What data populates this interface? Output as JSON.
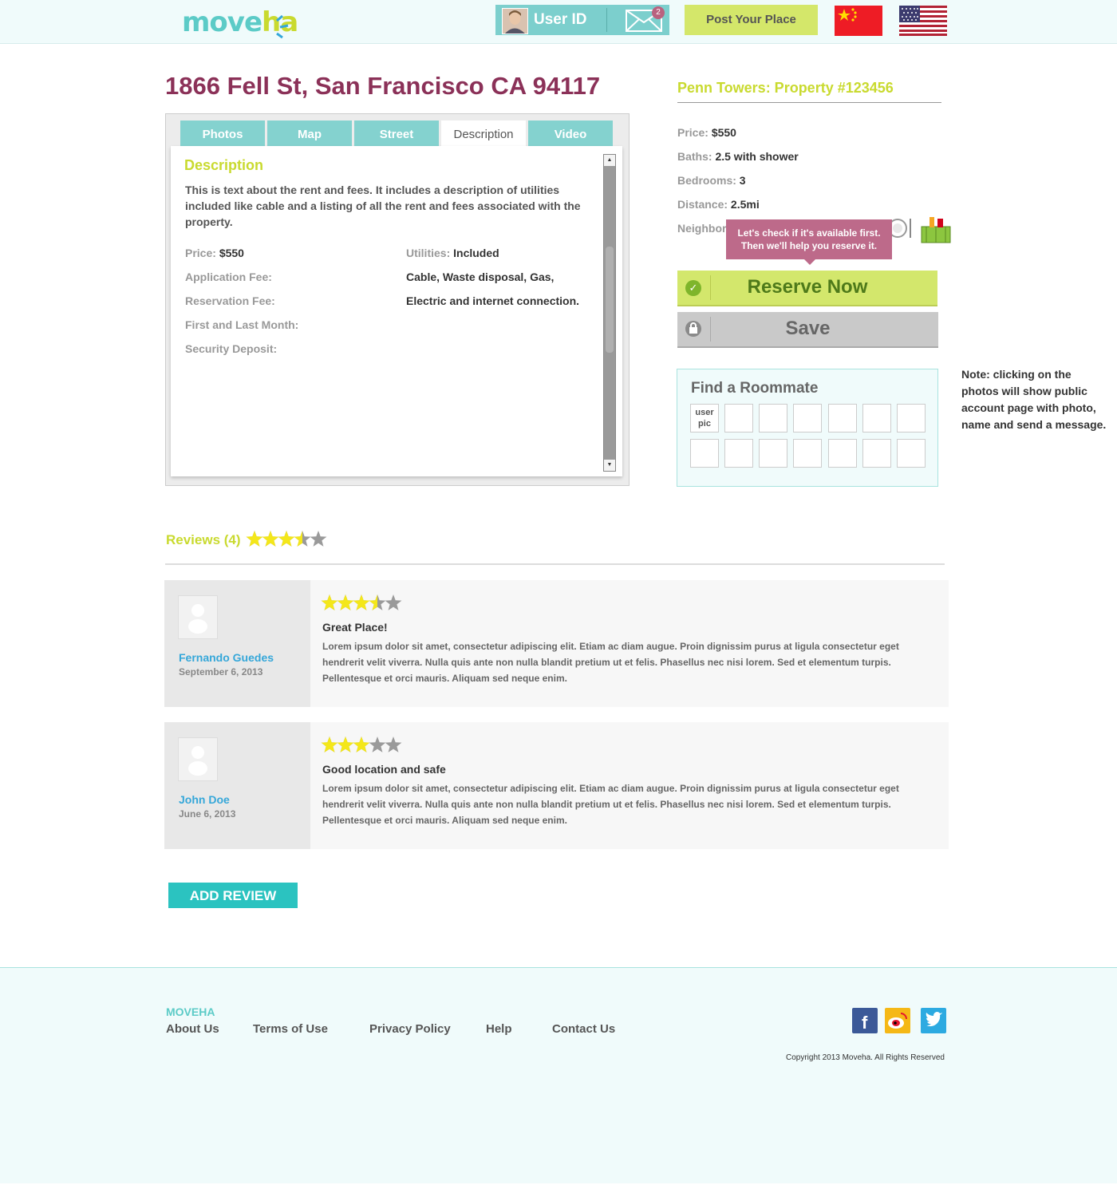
{
  "header": {
    "logo_part1": "move",
    "logo_part2": "ha",
    "user_label": "User ID",
    "mail_count": "2",
    "post_button": "Post Your Place",
    "flags": [
      "china-flag",
      "usa-flag"
    ]
  },
  "listing": {
    "address": "1866 Fell St, San Francisco CA 94117",
    "tabs": [
      "Photos",
      "Map",
      "Street",
      "Description",
      "Video"
    ],
    "active_tab": "Description",
    "description_heading": "Description",
    "description_text": "This is text about the rent and fees. It includes a description of utilities included like cable and a listing of all the rent and fees associated with the property.",
    "fees_left": {
      "price_label": "Price:",
      "price_value": "$550",
      "application_fee": "Application Fee:",
      "reservation_fee": "Reservation Fee:",
      "first_last": "First and Last Month:",
      "security_deposit": "Security Deposit:"
    },
    "fees_right": {
      "utilities_label": "Utilities:",
      "utilities_value": "Included",
      "line2": "Cable, Waste disposal, Gas,",
      "line3": "Electric and internet connection."
    }
  },
  "property": {
    "title": "Penn Towers:  Property #123456",
    "price_label": "Price:",
    "price_value": "$550",
    "baths_label": "Baths:",
    "baths_value": "2.5 with shower",
    "bedrooms_label": "Bedrooms:",
    "bedrooms_value": "3",
    "distance_label": "Distance:",
    "distance_value": "2.5mi",
    "neighborhood_label": "Neighbor",
    "tooltip_line1": "Let's check  if it's available first.",
    "tooltip_line2": "Then we'll help you reserve it.",
    "reserve_button": "Reserve Now",
    "save_button": "Save"
  },
  "roommate": {
    "title": "Find a Roommate",
    "user_pic_label_1": "user",
    "user_pic_label_2": "pic",
    "slots": 14
  },
  "note": "Note: clicking on the photos will show public account page with photo, name and send a message.",
  "reviews": {
    "title": "Reviews (4)",
    "average_rating": 3.5,
    "items": [
      {
        "name": "Fernando Guedes",
        "date": "September 6, 2013",
        "rating": 3.5,
        "title": "Great Place!",
        "body": "Lorem ipsum dolor sit amet, consectetur adipiscing elit. Etiam ac diam augue. Proin dignissim purus at ligula consectetur eget hendrerit velit viverra. Nulla quis ante non nulla blandit pretium ut et felis. Phasellus nec nisi lorem. Sed et elementum turpis. Pellentesque et orci mauris. Aliquam sed neque enim."
      },
      {
        "name": "John Doe",
        "date": "June 6, 2013",
        "rating": 3,
        "title": "Good location and safe",
        "body": "Lorem ipsum dolor sit amet, consectetur adipiscing elit. Etiam ac diam augue. Proin dignissim purus at ligula consectetur eget hendrerit velit viverra. Nulla quis ante non nulla blandit pretium ut et felis. Phasellus nec nisi lorem. Sed et elementum turpis. Pellentesque et orci mauris. Aliquam sed neque enim."
      }
    ],
    "add_button": "ADD REVIEW"
  },
  "footer": {
    "brand": "MOVEHA",
    "links": [
      "About Us",
      "Terms of Use",
      "Privacy Policy",
      "Help",
      "Contact Us"
    ],
    "social": [
      "facebook-icon",
      "weibo-icon",
      "twitter-icon"
    ],
    "copyright": "Copyright 2013 Moveha.  All Rights Reserved"
  },
  "colors": {
    "accent_teal": "#5ccbc7",
    "accent_lime": "#c9da2f",
    "address_maroon": "#8b3158",
    "tooltip_pink": "#bd6a8a",
    "star_yellow": "#f4e71a",
    "star_grey": "#9a9a9a"
  }
}
